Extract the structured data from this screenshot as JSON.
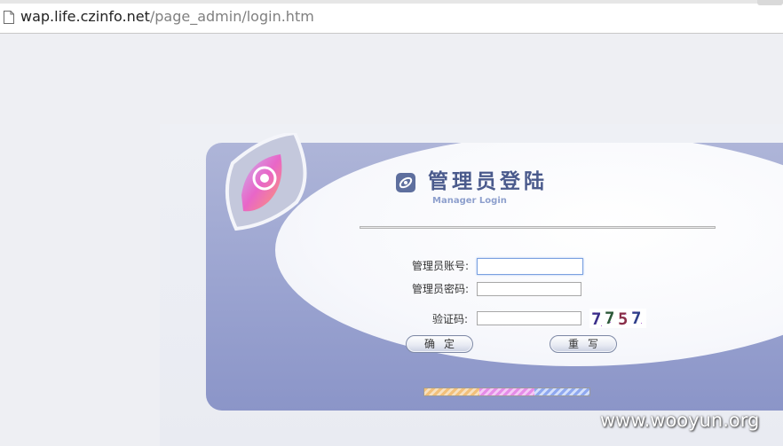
{
  "browser": {
    "url_host": "wap.life.czinfo.net",
    "url_path": "/page_admin/login.htm"
  },
  "login": {
    "title_cn": "管理员登陆",
    "title_en": "Manager Login",
    "account_label": "管理员账号:",
    "account_value": "",
    "password_label": "管理员密码:",
    "password_value": "",
    "captcha_label": "验证码:",
    "captcha_value": "",
    "captcha_text": "7757",
    "confirm_button": "确定",
    "reset_button": "重写"
  },
  "watermark": "www.wooyun.org",
  "colors": {
    "panel": "#9aa3d0",
    "title": "#4a5a8c",
    "subtitle": "#8d9fcd"
  }
}
